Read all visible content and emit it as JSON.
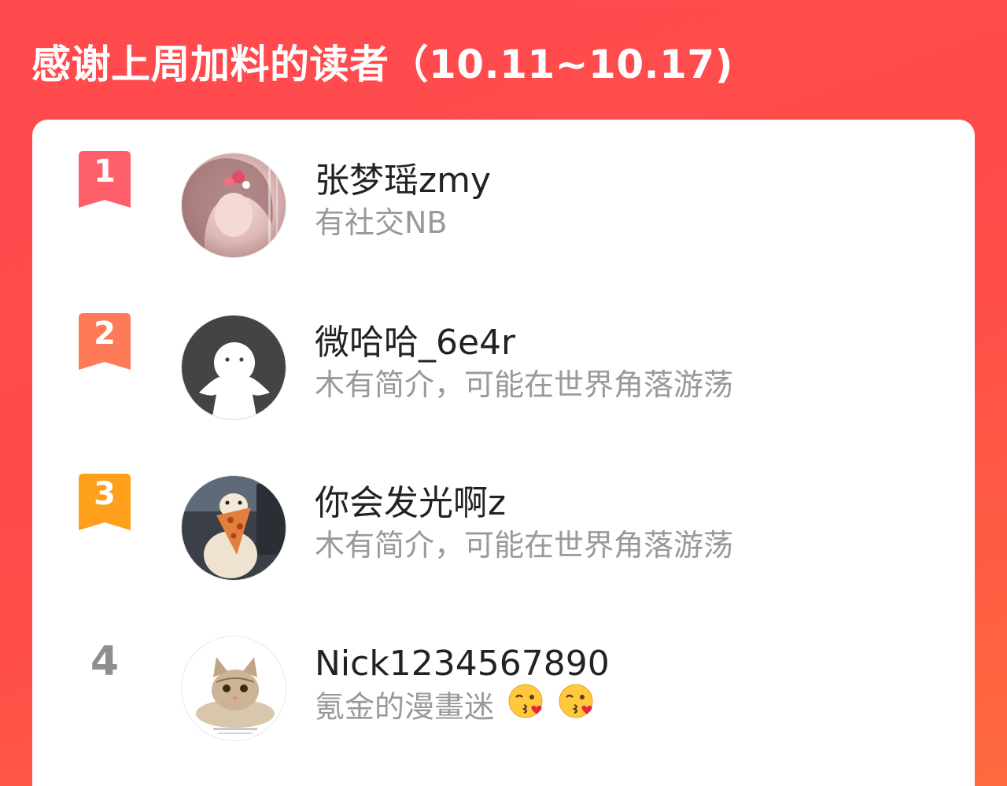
{
  "header": {
    "title": "感谢上周加料的读者（10.11~10.17)"
  },
  "colors": {
    "background": "#ff4a4f",
    "rank_1": "#ff5f6b",
    "rank_2": "#ff7a56",
    "rank_3": "#ffa01c",
    "name_text": "#222222",
    "bio_text": "#999999"
  },
  "readers": [
    {
      "rank": "1",
      "name": "张梦瑶zmy",
      "bio": "有社交NB",
      "avatar_icon": "anime-girl-avatar",
      "rank_badge_icon": "ribbon-badge-icon"
    },
    {
      "rank": "2",
      "name": "微哈哈_6e4r",
      "bio": "木有简介，可能在世界角落游荡",
      "avatar_icon": "default-ghost-avatar",
      "rank_badge_icon": "ribbon-badge-icon"
    },
    {
      "rank": "3",
      "name": "你会发光啊z",
      "bio": "木有简介，可能在世界角落游荡",
      "avatar_icon": "dog-pizza-avatar",
      "rank_badge_icon": "ribbon-badge-icon"
    },
    {
      "rank": "4",
      "name": "Nick1234567890",
      "bio": "氪金的漫畫迷",
      "bio_emojis": [
        "kissing-face-emoji",
        "kissing-face-emoji"
      ],
      "avatar_icon": "kitten-avatar"
    }
  ]
}
